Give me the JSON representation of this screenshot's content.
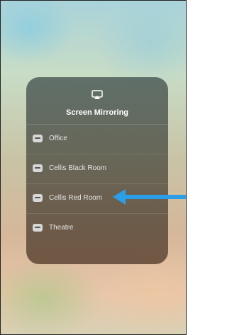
{
  "screen_mirroring": {
    "icon": "airplay-icon",
    "title": "Screen Mirroring",
    "devices": [
      {
        "label": "Office",
        "icon": "apple-tv-icon"
      },
      {
        "label": "Cellis Black Room",
        "icon": "apple-tv-icon"
      },
      {
        "label": "Cellis Red Room",
        "icon": "apple-tv-icon"
      },
      {
        "label": "Theatre",
        "icon": "apple-tv-icon"
      }
    ]
  },
  "annotation": {
    "icon": "arrow-left-icon",
    "color": "#2a9ee6"
  },
  "colors": {
    "panel_text": "#ffffff",
    "arrow": "#2a9ee6"
  }
}
